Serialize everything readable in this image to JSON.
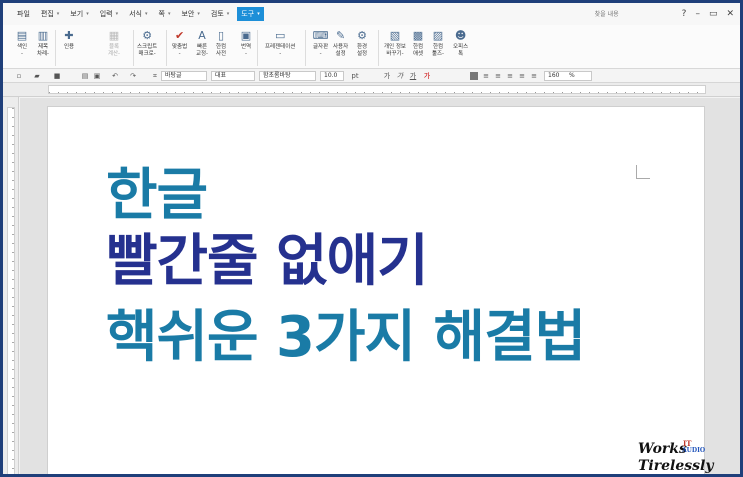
{
  "menubar": {
    "items": [
      {
        "label": "파일",
        "arrow": false
      },
      {
        "label": "편집",
        "arrow": true
      },
      {
        "label": "보기",
        "arrow": true
      },
      {
        "label": "입력",
        "arrow": true
      },
      {
        "label": "서식",
        "arrow": true
      },
      {
        "label": "쪽",
        "arrow": true
      },
      {
        "label": "보안",
        "arrow": true
      },
      {
        "label": "검토",
        "arrow": true
      },
      {
        "label": "도구",
        "arrow": true
      }
    ],
    "arrow_glyph": "▾",
    "search_placeholder": "찾을 내용",
    "help_glyph": "?",
    "minimize_glyph": "–",
    "restore_glyph": "▭",
    "close_glyph": "✕"
  },
  "ribbon": {
    "buttons": [
      {
        "label1": "색인",
        "label2": "-",
        "icon": "index-icon"
      },
      {
        "label1": "제목",
        "label2": "차례-",
        "icon": "toc-icon"
      },
      {
        "label1": "인용",
        "label2": "",
        "icon": "citation-icon"
      },
      {
        "label1": "블록",
        "label2": "계산-",
        "icon": "calc-icon",
        "dim": true
      },
      {
        "label1": "스크립트",
        "label2": "매크로-",
        "icon": "script-macro-icon"
      },
      {
        "label1": "맞춤법",
        "label2": "-",
        "icon": "spellcheck-icon"
      },
      {
        "label1": "빠른",
        "label2": "교정-",
        "icon": "quick-correct-icon"
      },
      {
        "label1": "한컴",
        "label2": "사전",
        "icon": "dictionary-icon"
      },
      {
        "label1": "번역",
        "label2": "-",
        "icon": "translate-icon"
      },
      {
        "label1": "프레젠테이션",
        "label2": "-",
        "icon": "presentation-icon"
      },
      {
        "label1": "글자판",
        "label2": "-",
        "icon": "keyboard-icon"
      },
      {
        "label1": "사용자",
        "label2": "설정",
        "icon": "user-settings-icon"
      },
      {
        "label1": "환경",
        "label2": "설정",
        "icon": "gear-icon"
      },
      {
        "label1": "개인 정보",
        "label2": "바꾸기-",
        "icon": "privacy-icon"
      },
      {
        "label1": "한컴",
        "label2": "애셋",
        "icon": "asset-icon"
      },
      {
        "label1": "한컴",
        "label2": "툴즈-",
        "icon": "tools-icon"
      },
      {
        "label1": "오피스",
        "label2": "톡",
        "icon": "office-talk-icon"
      }
    ]
  },
  "toolbar2": {
    "style_value": "바탕글",
    "lang_value": "대표",
    "font_value": "함초롬바탕",
    "size_value": "10.0",
    "size_unit": "pt",
    "zoom_value": "160",
    "zoom_unit": "%",
    "bold_glyph": "가",
    "italic_glyph": "가",
    "underline_glyph": "가",
    "color_glyph": "가"
  },
  "document": {
    "line1": "한글",
    "line2": "빨간줄 없애기",
    "line3": "핵쉬운 3가지 해결법"
  },
  "watermark": {
    "line1": "Works",
    "line2": "Tirelessly",
    "it": "IT",
    "audio": "AUDIO"
  },
  "colors": {
    "accent": "#1d8fd8",
    "title_teal": "#1a7ba6",
    "title_navy": "#25318f",
    "frame": "#1f3f7a"
  }
}
